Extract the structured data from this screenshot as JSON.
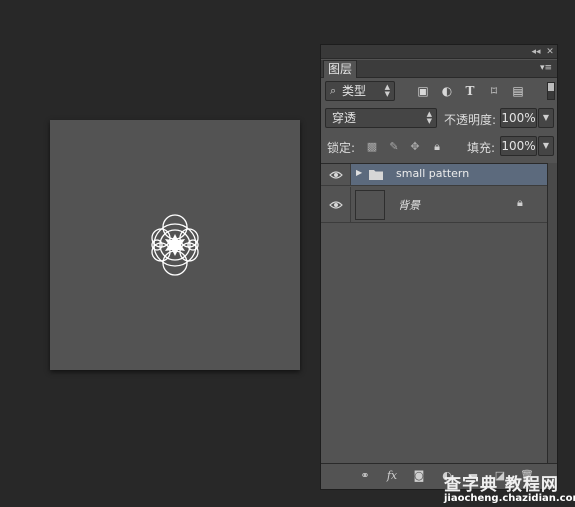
{
  "panel": {
    "collapse_glyph": "◂◂",
    "close_glyph": "✕",
    "tab_label": "图层",
    "menu_glyph": "▾≡"
  },
  "filter": {
    "value": "类型",
    "search_glyph": "⌕",
    "icons": [
      "image-filter-icon",
      "adjustment-filter-icon",
      "type-filter-icon",
      "shape-filter-icon",
      "smart-object-filter-icon"
    ]
  },
  "blend": {
    "mode": "穿透",
    "opacity_label": "不透明度:",
    "opacity_value": "100%"
  },
  "lock": {
    "label": "锁定:",
    "fill_label": "填充:",
    "fill_value": "100%"
  },
  "layers": [
    {
      "name": "small pattern",
      "type": "group",
      "selected": true,
      "visible": true
    },
    {
      "name": "背景",
      "type": "background",
      "selected": false,
      "visible": true,
      "locked": true
    }
  ],
  "footer": {
    "fx_label": "fx"
  },
  "watermark": {
    "title": "查字典 教程网",
    "url": "jiaocheng.chazidian.com"
  },
  "colors": {
    "workspace": "#282828",
    "panel": "#535353",
    "selected_layer": "#5c6a7d",
    "canvas": "#535353"
  }
}
